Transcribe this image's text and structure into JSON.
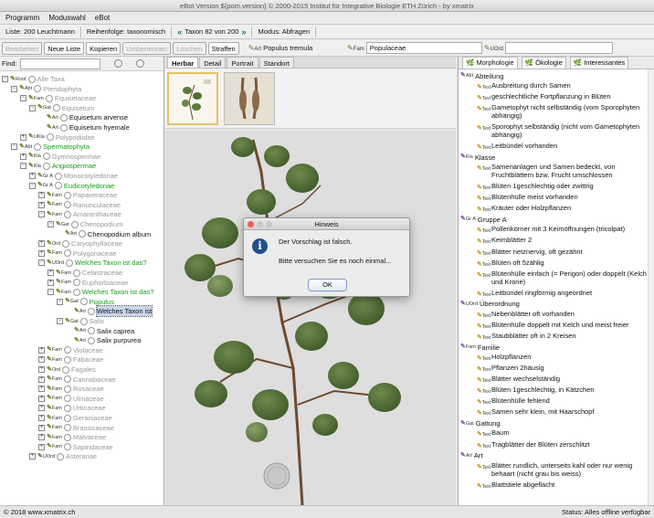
{
  "window": {
    "title": "eBot Version ${pom.version} © 2000-2015 Institut für Integrative Biologie ETH Zürich - by xmatrix"
  },
  "menu": [
    "Programm",
    "Moduswahl",
    "eBot"
  ],
  "infobar": {
    "list": "Liste: 200 Leuchtmann",
    "order": "Reihenfolge: taxonomisch",
    "prev_icon": "double-left-arrow",
    "position": "Taxon 82 von 200",
    "next_icon": "double-right-arrow",
    "mode": "Modus: Abfragen"
  },
  "toolbar": {
    "buttons": [
      {
        "label": "Bearbeiten",
        "enabled": false
      },
      {
        "label": "Neue Liste",
        "enabled": true
      },
      {
        "label": "Kopieren",
        "enabled": true
      },
      {
        "label": "Umbenennen",
        "enabled": false
      },
      {
        "label": "Löschen",
        "enabled": false
      },
      {
        "label": "Straffen",
        "enabled": true
      }
    ],
    "taxon_rank": "Art",
    "taxon_name": "Populus tremula",
    "family_rank": "Fam",
    "family_value": "Populaceae",
    "order_rank": "UOrd",
    "order_value": ""
  },
  "find": {
    "label": "Find:",
    "value": ""
  },
  "tree": [
    {
      "d": 0,
      "tg": "−",
      "rank": "Root",
      "label": "Alle Taxa",
      "color": "gray"
    },
    {
      "d": 1,
      "tg": "−",
      "rank": "Abt",
      "label": "Pteridophyta",
      "color": "gray"
    },
    {
      "d": 2,
      "tg": "−",
      "rank": "Fam",
      "label": "Equisetaceae",
      "color": "gray"
    },
    {
      "d": 3,
      "tg": "−",
      "rank": "Gat",
      "label": "Equisetum",
      "color": "gray"
    },
    {
      "d": 4,
      "tg": "",
      "rank": "Art",
      "label": "Equisetum arvense",
      "color": "black"
    },
    {
      "d": 4,
      "tg": "",
      "rank": "Art",
      "label": "Equisetum hyemale",
      "color": "black"
    },
    {
      "d": 2,
      "tg": "+",
      "rank": "UKla",
      "label": "Polypodiidae",
      "color": "gray"
    },
    {
      "d": 1,
      "tg": "−",
      "rank": "Abt",
      "label": "Spermatophyta",
      "color": "green"
    },
    {
      "d": 2,
      "tg": "+",
      "rank": "Kla",
      "label": "Gymnospermae",
      "color": "gray"
    },
    {
      "d": 2,
      "tg": "−",
      "rank": "Kla",
      "label": "Angiospermae",
      "color": "green"
    },
    {
      "d": 3,
      "tg": "+",
      "rank": "Gr A",
      "label": "Monocotyledonae",
      "color": "gray"
    },
    {
      "d": 3,
      "tg": "−",
      "rank": "Gr A",
      "label": "Eudicotyledonae",
      "color": "green"
    },
    {
      "d": 4,
      "tg": "+",
      "rank": "Fam",
      "label": "Papaveraceae",
      "color": "gray"
    },
    {
      "d": 4,
      "tg": "+",
      "rank": "Fam",
      "label": "Ranunculaceae",
      "color": "gray"
    },
    {
      "d": 4,
      "tg": "−",
      "rank": "Fam",
      "label": "Amaranthaceae",
      "color": "gray"
    },
    {
      "d": 5,
      "tg": "−",
      "rank": "Gat",
      "label": "Chenopodium",
      "color": "gray"
    },
    {
      "d": 6,
      "tg": "",
      "rank": "Art",
      "label": "Chenopodium album",
      "color": "black"
    },
    {
      "d": 4,
      "tg": "+",
      "rank": "Ord",
      "label": "Caryophyllaceae",
      "color": "gray"
    },
    {
      "d": 4,
      "tg": "+",
      "rank": "Fam",
      "label": "Polygonaceae",
      "color": "gray"
    },
    {
      "d": 4,
      "tg": "−",
      "rank": "UOrd",
      "label": "Welches Taxon ist das?",
      "color": "green"
    },
    {
      "d": 5,
      "tg": "+",
      "rank": "Fam",
      "label": "Celastraceae",
      "color": "gray"
    },
    {
      "d": 5,
      "tg": "+",
      "rank": "Fam",
      "label": "Euphorbiaceae",
      "color": "gray"
    },
    {
      "d": 5,
      "tg": "−",
      "rank": "Fam",
      "label": "Welches Taxon ist das?",
      "color": "green"
    },
    {
      "d": 6,
      "tg": "−",
      "rank": "Gat",
      "label": "Populus",
      "color": "green"
    },
    {
      "d": 7,
      "tg": "",
      "rank": "Art",
      "label": "Welches Taxon ist",
      "color": "black",
      "selected": true
    },
    {
      "d": 6,
      "tg": "−",
      "rank": "Gat",
      "label": "Salix",
      "color": "gray"
    },
    {
      "d": 7,
      "tg": "",
      "rank": "Art",
      "label": "Salix caprea",
      "color": "black"
    },
    {
      "d": 7,
      "tg": "",
      "rank": "Art",
      "label": "Salix purpurea",
      "color": "black"
    },
    {
      "d": 4,
      "tg": "+",
      "rank": "Fam",
      "label": "Violaceae",
      "color": "gray"
    },
    {
      "d": 4,
      "tg": "+",
      "rank": "Fam",
      "label": "Fabaceae",
      "color": "gray"
    },
    {
      "d": 4,
      "tg": "+",
      "rank": "Ord",
      "label": "Fagales",
      "color": "gray"
    },
    {
      "d": 4,
      "tg": "+",
      "rank": "Fam",
      "label": "Cannabaceae",
      "color": "gray"
    },
    {
      "d": 4,
      "tg": "+",
      "rank": "Fam",
      "label": "Rosaceae",
      "color": "gray"
    },
    {
      "d": 4,
      "tg": "+",
      "rank": "Fam",
      "label": "Ulmaceae",
      "color": "gray"
    },
    {
      "d": 4,
      "tg": "+",
      "rank": "Fam",
      "label": "Urticaceae",
      "color": "gray"
    },
    {
      "d": 4,
      "tg": "+",
      "rank": "Fam",
      "label": "Geraniaceae",
      "color": "gray"
    },
    {
      "d": 4,
      "tg": "+",
      "rank": "Fam",
      "label": "Brassicaceae",
      "color": "gray"
    },
    {
      "d": 4,
      "tg": "+",
      "rank": "Fam",
      "label": "Malvaceae",
      "color": "gray"
    },
    {
      "d": 4,
      "tg": "+",
      "rank": "Fam",
      "label": "Sapindaceae",
      "color": "gray"
    },
    {
      "d": 3,
      "tg": "+",
      "rank": "UOrd",
      "label": "Asteranae",
      "color": "gray"
    }
  ],
  "center_tabs": [
    {
      "label": "Herbar",
      "active": true
    },
    {
      "label": "Detail",
      "active": false
    },
    {
      "label": "Portrait",
      "active": false
    },
    {
      "label": "Standort",
      "active": false
    }
  ],
  "right_tabs": [
    {
      "label": "Morphologie",
      "active": true
    },
    {
      "label": "Ökologie",
      "active": false
    },
    {
      "label": "Interessantes",
      "active": false
    }
  ],
  "traits": [
    {
      "type": "cat",
      "rank": "Abt",
      "label": "Abteilung"
    },
    {
      "type": "txt",
      "label": "Ausbreitung durch Samen"
    },
    {
      "type": "txt",
      "label": "geschlechtliche Fortpflanzung in Blüten"
    },
    {
      "type": "txt",
      "label": "Gametophyt nicht selbständig (vom Sporophyten abhängig)"
    },
    {
      "type": "txt",
      "label": "Sporophyt selbständig (nicht vom Gametophyten abhängig)"
    },
    {
      "type": "txt",
      "label": "Leitbündel vorhanden"
    },
    {
      "type": "cat",
      "rank": "Kla",
      "label": "Klasse"
    },
    {
      "type": "txt",
      "label": "Samenanlagen und Samen bedeckt, von Fruchtblättern bzw. Frucht umschlossen"
    },
    {
      "type": "txt",
      "label": "Blüten 1geschlechtig oder zwittrig"
    },
    {
      "type": "txt",
      "label": "Blütenhülle meist vorhanden"
    },
    {
      "type": "txt",
      "label": "Kräuter oder Holzpflanzen"
    },
    {
      "type": "cat",
      "rank": "Gr A",
      "label": "Gruppe A"
    },
    {
      "type": "txt",
      "label": "Pollenkörner mit 3 Keimöffnungen (tricolpat)"
    },
    {
      "type": "txt",
      "label": "Keimblätter 2"
    },
    {
      "type": "txt",
      "label": "Blätter netznervig, oft gezähnt"
    },
    {
      "type": "txt",
      "label": "Blüten oft 5zählig"
    },
    {
      "type": "txt",
      "label": "Blütenhülle einfach (= Perigon) oder doppelt (Kelch und Krone)"
    },
    {
      "type": "txt",
      "label": "Leitbündel ringförmig angeordnet"
    },
    {
      "type": "cat",
      "rank": "UOrd",
      "label": "Überordnung"
    },
    {
      "type": "txt",
      "label": "Nebenblätter oft vorhanden"
    },
    {
      "type": "txt",
      "label": "Blütenhülle doppelt mit Kelch und meist freier"
    },
    {
      "type": "txt",
      "label": "Staubblätter oft in 2 Kreisen"
    },
    {
      "type": "cat",
      "rank": "Fam",
      "label": "Familie"
    },
    {
      "type": "txt",
      "label": "Holzpflanzen"
    },
    {
      "type": "txt",
      "label": "Pflanzen 2häusig"
    },
    {
      "type": "txt",
      "label": "Blätter wechselständig"
    },
    {
      "type": "txt",
      "label": "Blüten 1geschlechtig, in Kätzchen"
    },
    {
      "type": "txt",
      "label": "Blütenhülle fehlend"
    },
    {
      "type": "txt",
      "label": "Samen sehr klein, mit Haarschopf"
    },
    {
      "type": "cat",
      "rank": "Gat",
      "label": "Gattung"
    },
    {
      "type": "txt",
      "label": "Baum"
    },
    {
      "type": "txt",
      "label": "Tragblätter der Blüten zerschlitzt"
    },
    {
      "type": "cat",
      "rank": "Art",
      "label": "Art"
    },
    {
      "type": "txt",
      "label": "Blätter rundlich, unterseits kahl oder nur wenig behaart (nicht grau bis weiss)"
    },
    {
      "type": "txt",
      "label": "Blattstiele abgeflacht"
    }
  ],
  "dialog": {
    "title": "Hinweis",
    "message": "Der Vorschlag ist falsch.",
    "hint": "Bitte versuchen Sie es noch einmal...",
    "ok": "OK",
    "icon": "info-icon"
  },
  "status": {
    "left": "© 2018 www.xmatrix.ch",
    "right": "Status: Alles offline verfügbar"
  }
}
